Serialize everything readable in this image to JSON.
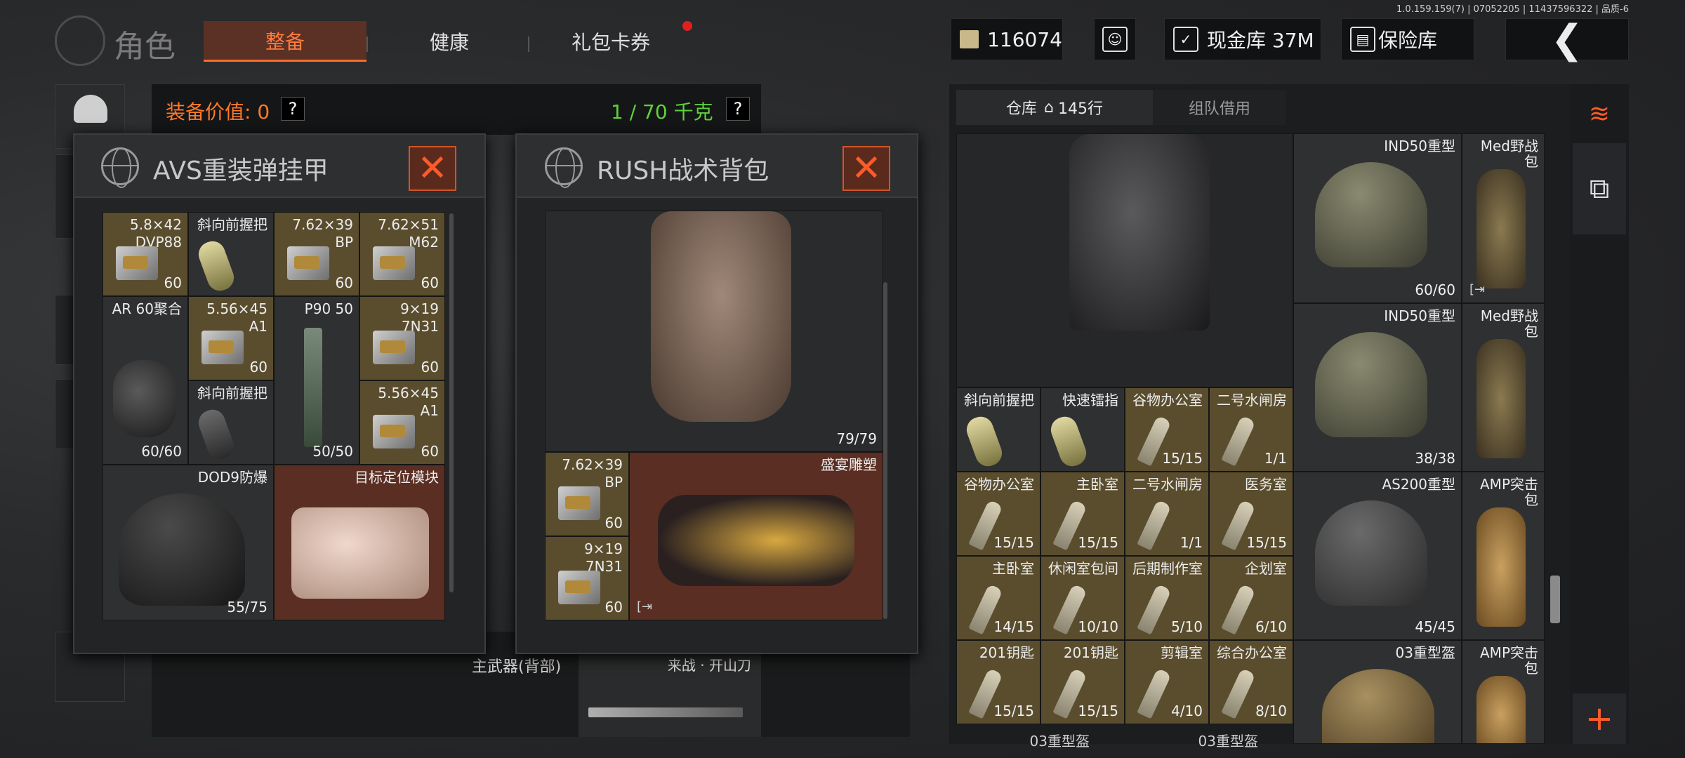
{
  "version": "1.0.159.159(7) | 07052205 | 11437596322 | 品质-6",
  "header": {
    "title": "角色",
    "tabs": [
      {
        "label": "整备",
        "active": true
      },
      {
        "label": "健康",
        "active": false
      },
      {
        "label": "礼包卡券",
        "active": false
      }
    ],
    "currency": "116074",
    "cash_vault": "现金库 37M",
    "safe_box": "保险库"
  },
  "equip_bar": {
    "value_label": "装备价值: 0",
    "help": "?",
    "weight": "1 / 70 千克"
  },
  "armor_panel": {
    "title": "AVS重装弹挂甲",
    "close": "✕",
    "items": [
      {
        "name": "5.8×42",
        "sub": "DVP88",
        "count": "60",
        "color": "gold"
      },
      {
        "name": "斜向前握把",
        "count": "",
        "color": "dark"
      },
      {
        "name": "7.62×39",
        "sub": "BP",
        "count": "60",
        "color": "gold"
      },
      {
        "name": "7.62×51",
        "sub": "M62",
        "count": "60",
        "color": "gold"
      },
      {
        "name": "AR 60聚合",
        "count": "60/60",
        "color": "dark"
      },
      {
        "name": "5.56×45",
        "sub": "A1",
        "count": "60",
        "color": "gold"
      },
      {
        "name": "P90 50",
        "count": "50/50",
        "color": "dark"
      },
      {
        "name": "9×19",
        "sub": "7N31",
        "count": "60",
        "color": "gold"
      },
      {
        "name": "斜向前握把",
        "count": "",
        "color": "dark"
      },
      {
        "name": "5.56×45",
        "sub": "A1",
        "count": "60",
        "color": "gold"
      },
      {
        "name": "DOD9防爆",
        "count": "55/75",
        "color": "dark"
      },
      {
        "name": "目标定位模块",
        "count": "",
        "color": "red"
      }
    ]
  },
  "backpack_panel": {
    "title": "RUSH战术背包",
    "close": "✕",
    "vest_count": "79/79",
    "items": [
      {
        "name": "7.62×39",
        "sub": "BP",
        "count": "60",
        "color": "gold"
      },
      {
        "name": "9×19",
        "sub": "7N31",
        "count": "60",
        "color": "gold"
      },
      {
        "name": "盛宴雕塑",
        "link": "[⇥",
        "color": "red"
      }
    ]
  },
  "weapon_slots": {
    "primary_back": "主武器(背部)",
    "melee": "来战 · 开山刀"
  },
  "warehouse": {
    "tab_label": "仓库",
    "rows": "145行",
    "team_borrow": "组队借用",
    "right_items": [
      {
        "name": "IND50重型",
        "count": "60/60"
      },
      {
        "name": "Med野战包",
        "count": ""
      },
      {
        "name": "IND50重型",
        "count": "38/38"
      },
      {
        "name": "Med野战包",
        "count": ""
      },
      {
        "name": "AS200重型",
        "count": "45/45"
      },
      {
        "name": "AMP突击包",
        "count": ""
      },
      {
        "name": "03重型盔",
        "count": ""
      },
      {
        "name": "AMP突击包",
        "count": ""
      }
    ],
    "grid_items": [
      {
        "name": "斜向前握把",
        "count": "",
        "color": "dark"
      },
      {
        "name": "快速镭指",
        "count": "",
        "color": "dark"
      },
      {
        "name": "谷物办公室",
        "count": "15/15",
        "color": "gold"
      },
      {
        "name": "二号水闸房",
        "count": "1/1",
        "color": "gold"
      },
      {
        "name": "谷物办公室",
        "count": "15/15",
        "color": "gold"
      },
      {
        "name": "主卧室",
        "count": "15/15",
        "color": "gold"
      },
      {
        "name": "二号水闸房",
        "count": "1/1",
        "color": "gold"
      },
      {
        "name": "医务室",
        "count": "15/15",
        "color": "gold"
      },
      {
        "name": "主卧室",
        "count": "14/15",
        "color": "gold"
      },
      {
        "name": "休闲室包间",
        "count": "10/10",
        "color": "gold"
      },
      {
        "name": "后期制作室",
        "count": "5/10",
        "color": "gold"
      },
      {
        "name": "企划室",
        "count": "6/10",
        "color": "gold"
      },
      {
        "name": "201钥匙",
        "count": "15/15",
        "color": "gold"
      },
      {
        "name": "201钥匙",
        "count": "15/15",
        "color": "gold"
      },
      {
        "name": "剪辑室",
        "count": "4/10",
        "color": "gold"
      },
      {
        "name": "综合办公室",
        "count": "8/10",
        "color": "gold"
      }
    ],
    "bottom_labels": [
      "03重型盔",
      "03重型盔"
    ]
  }
}
